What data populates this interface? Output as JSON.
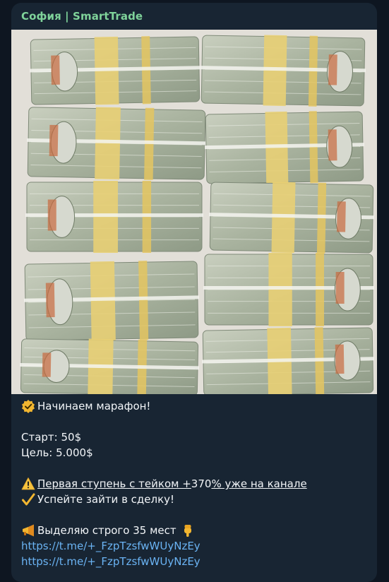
{
  "message": {
    "sender": "София | SmartTrade",
    "photo_alt": "stacks of 100-dollar banknotes",
    "lines": {
      "intro": "Начинаем  марафон!",
      "start": "Старт: 50$",
      "goal": "Цель: 5.000$",
      "step_a": "Первая ступень с тейком +",
      "step_b": "370",
      "step_c": "% уже на канале",
      "enter": "Успейте зайти в сделку!",
      "seats": "Выделяю строго 35  мест",
      "link1": "https://t.me/+_FzpTzsfwWUyNzEy",
      "link2": "https://t.me/+_FzpTzsfwWUyNzEy"
    },
    "icons": {
      "intro": "verified-check-icon",
      "warning": "warning-icon",
      "check": "checkmark-icon",
      "megaphone": "megaphone-icon",
      "point": "pointing-down-icon"
    },
    "colors": {
      "sender": "#7fd39a",
      "link": "#6ab3f3",
      "bubble": "#182533",
      "background": "#0e1621"
    }
  }
}
